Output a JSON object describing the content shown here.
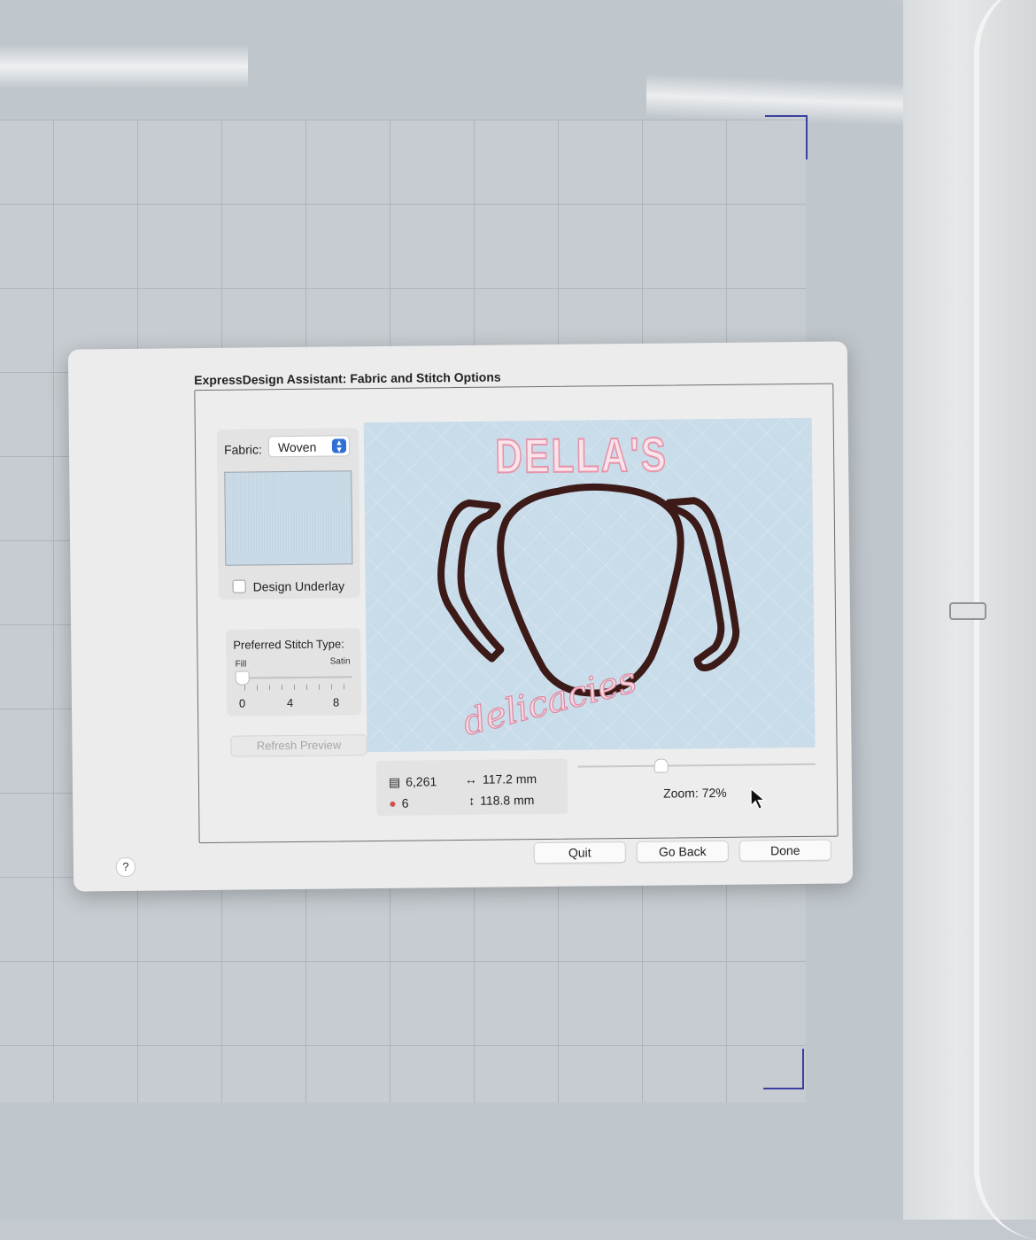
{
  "dialog": {
    "title": "ExpressDesign Assistant: Fabric and Stitch Options"
  },
  "fabric": {
    "label": "Fabric:",
    "selected": "Woven",
    "swatch_color": "#c5d6e4",
    "design_underlay_label": "Design Underlay",
    "design_underlay_checked": false
  },
  "stitch": {
    "title": "Preferred Stitch Type:",
    "min_label": "Fill",
    "max_label": "Satin",
    "scale_labels": [
      "0",
      "4",
      "8"
    ],
    "value": 0
  },
  "refresh_label": "Refresh Preview",
  "preview": {
    "design_text_top": "DELLA'S",
    "design_text_script": "delicacies",
    "thread_colors": [
      "#f2a9b9",
      "#3b1a18"
    ],
    "background_color": "#c9dcea"
  },
  "stats": {
    "stitch_count": "6,261",
    "color_count": "6",
    "width": "117.2 mm",
    "height": "118.8 mm"
  },
  "zoom": {
    "label": "Zoom: 72%",
    "value_percent": 72
  },
  "buttons": {
    "quit": "Quit",
    "go_back": "Go Back",
    "done": "Done",
    "help": "?"
  }
}
